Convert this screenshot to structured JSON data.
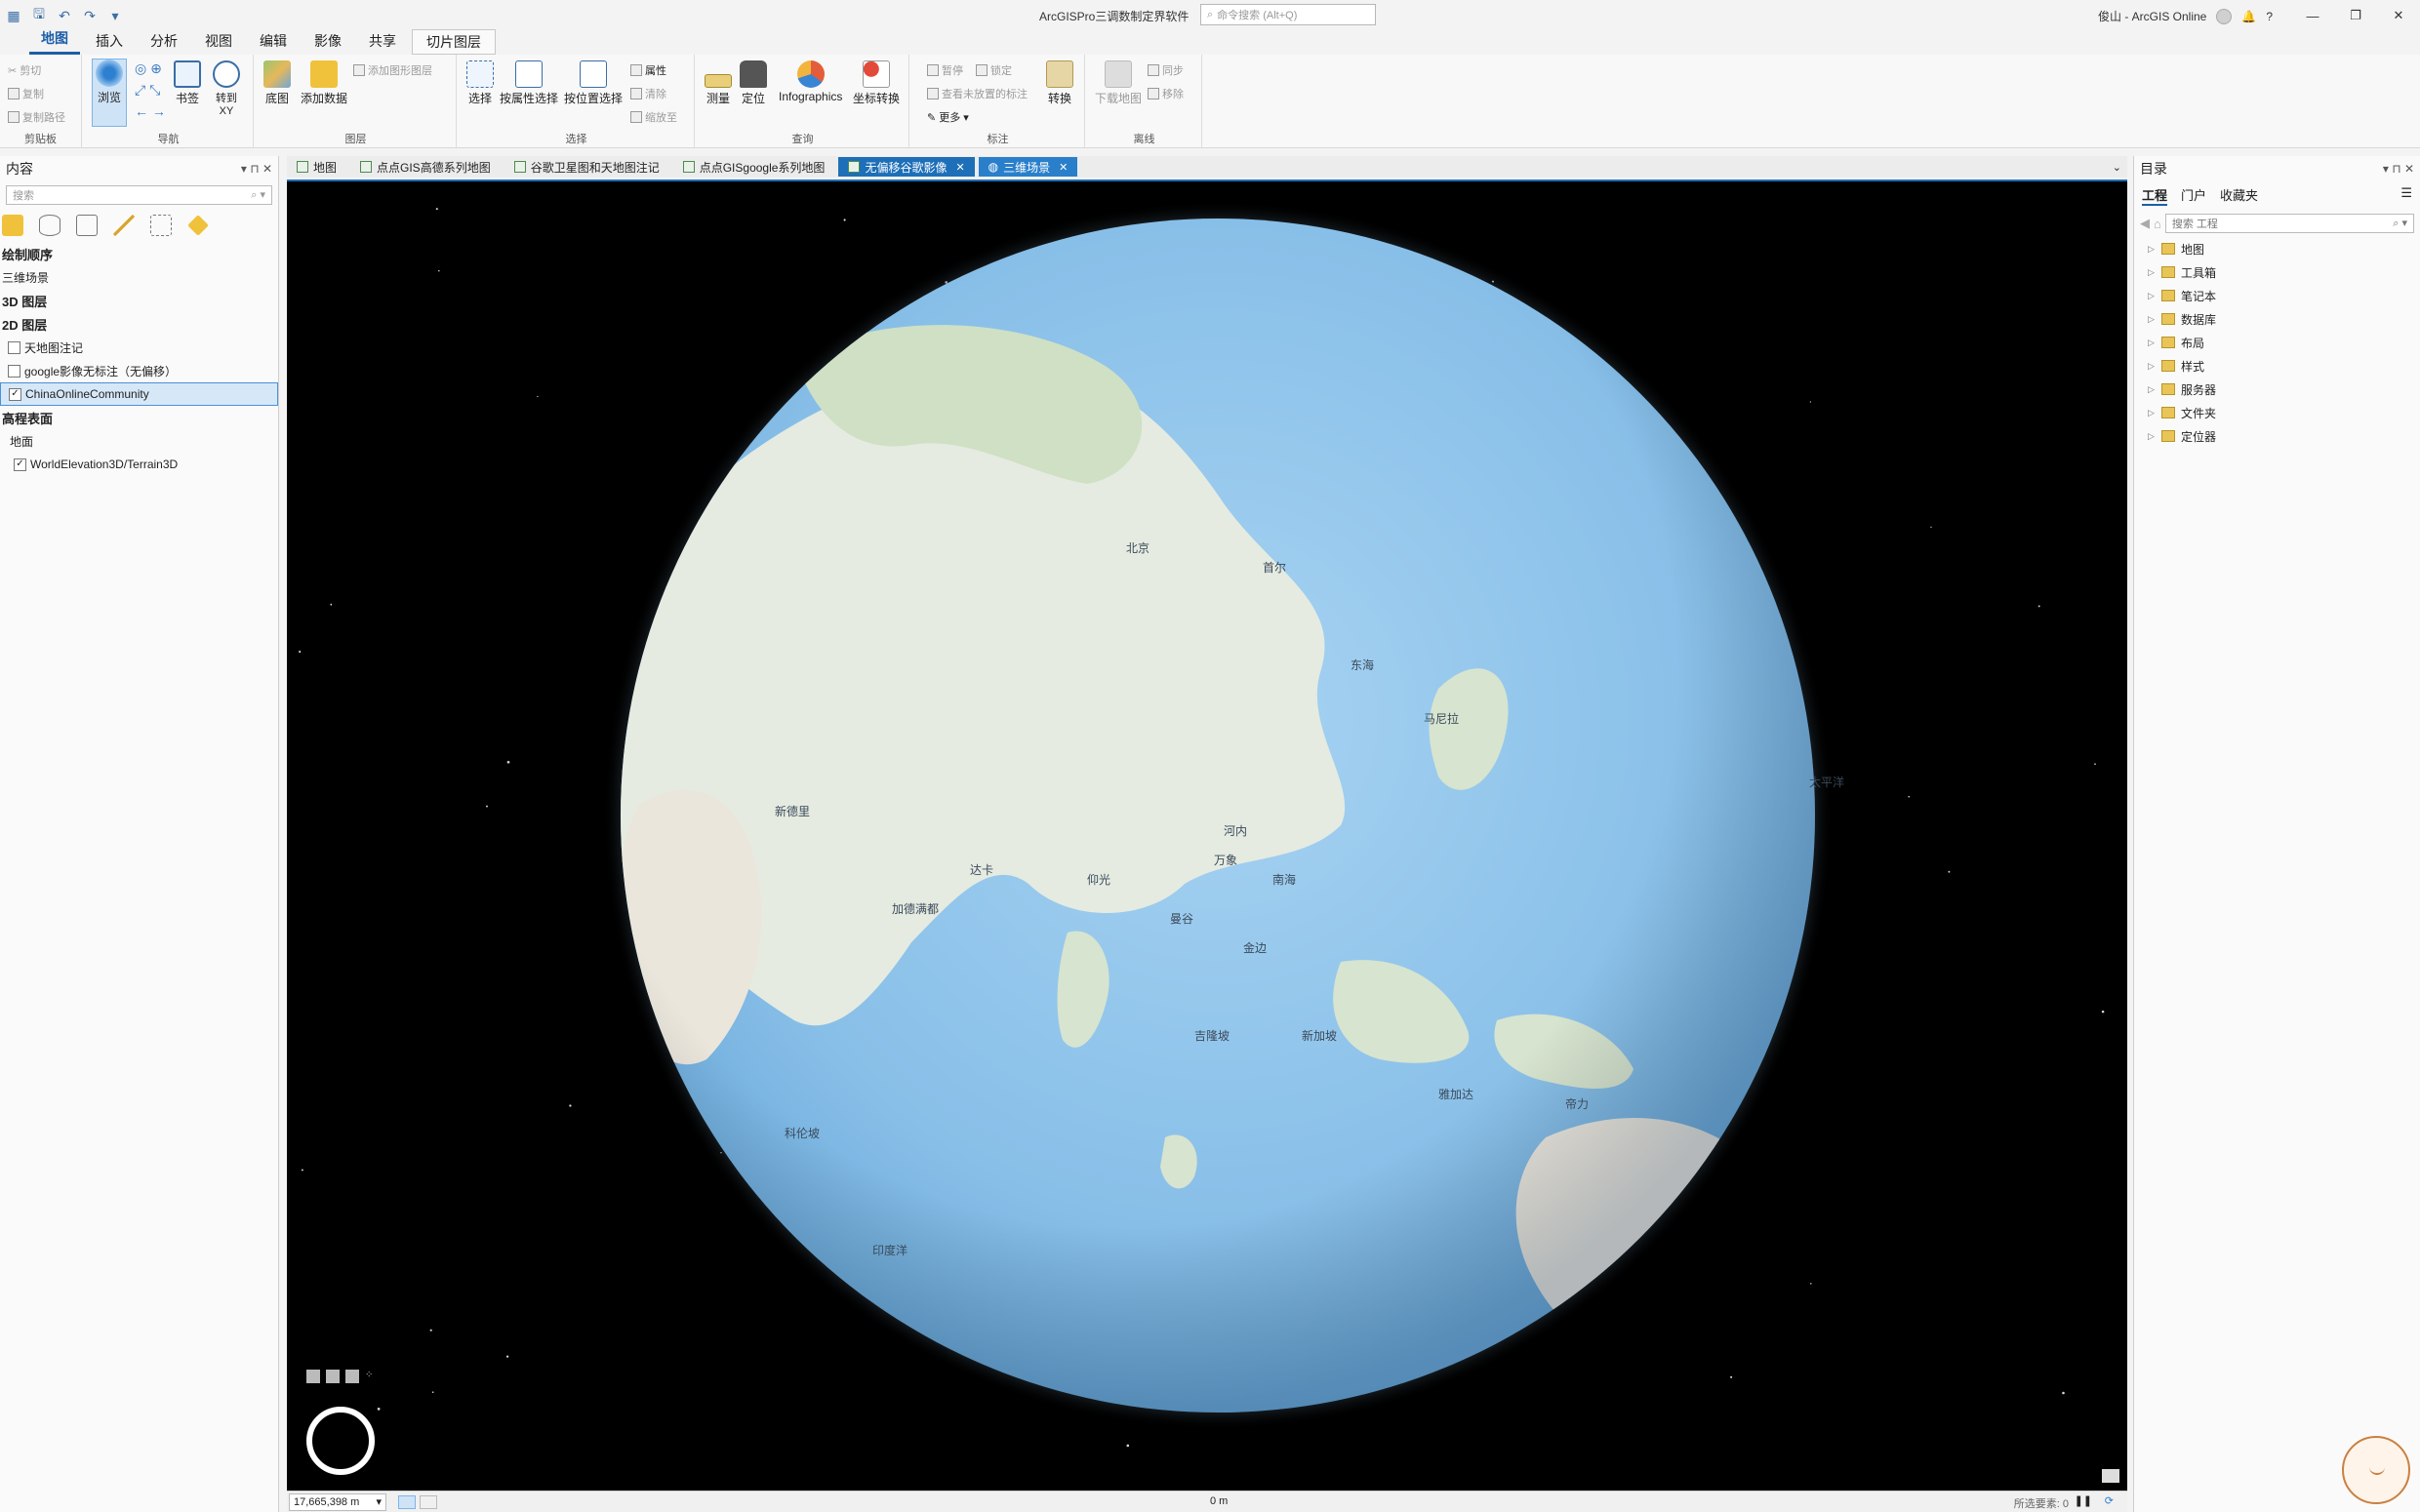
{
  "titlebar": {
    "title": "ArcGISPro三调数制定界软件",
    "search_placeholder": "命令搜索 (Alt+Q)",
    "user": "俊山 - ArcGIS Online",
    "help": "?"
  },
  "ribbon_tabs": [
    "地图",
    "插入",
    "分析",
    "视图",
    "编辑",
    "影像",
    "共享"
  ],
  "ribbon_context_tab": "切片图层",
  "ribbon": {
    "clipboard": {
      "cut": "剪切",
      "copy": "复制",
      "copy_path": "复制路径",
      "label": "剪贴板"
    },
    "navigate": {
      "explore": "浏览",
      "bookmarks": "书签",
      "goto_xy": "转到 XY",
      "label": "导航"
    },
    "layer": {
      "basemap": "底图",
      "add_data": "添加数据",
      "add_graphics": "添加图形图层",
      "label": "图层"
    },
    "selection": {
      "select": "选择",
      "by_attr": "按属性选择",
      "by_loc": "按位置选择",
      "attributes": "属性",
      "clear": "清除",
      "zoom_to": "缩放至",
      "label": "选择"
    },
    "inquiry": {
      "measure": "测量",
      "locate": "定位",
      "infographics": "Infographics",
      "convert_coords": "坐标转换",
      "label": "查询"
    },
    "labeling": {
      "pause": "暂停",
      "lock": "锁定",
      "view_unplaced": "查看未放置的标注",
      "more": "更多",
      "convert": "转换",
      "label": "标注"
    },
    "offline": {
      "download": "下载地图",
      "sync": "同步",
      "remove": "移除",
      "label": "离线"
    }
  },
  "contents": {
    "title": "内容",
    "search_placeholder": "搜索",
    "draw_order": "绘制顺序",
    "scene": "三维场景",
    "layers_3d": "3D 图层",
    "layers_2d": "2D 图层",
    "layer_items": [
      {
        "name": "天地图注记",
        "checked": false
      },
      {
        "name": "google影像无标注（无偏移）",
        "checked": false
      },
      {
        "name": "ChinaOnlineCommunity",
        "checked": true
      }
    ],
    "elevation": "高程表面",
    "ground": "地面",
    "elevation_item": {
      "name": "WorldElevation3D/Terrain3D",
      "checked": true
    }
  },
  "map_tabs": [
    {
      "label": "地图"
    },
    {
      "label": "点点GIS高德系列地图"
    },
    {
      "label": "谷歌卫星图和天地图注记"
    },
    {
      "label": "点点GISgoogle系列地图"
    },
    {
      "label": "无偏移谷歌影像",
      "active": true
    },
    {
      "label": "三维场景",
      "globe": true
    }
  ],
  "map": {
    "labels": [
      "北京",
      "马尼拉",
      "河内",
      "万象",
      "曼谷",
      "金边",
      "仰光",
      "达卡",
      "加德满都",
      "新德里",
      "科伦坡",
      "吉隆坡",
      "新加坡",
      "雅加达",
      "帝力",
      "首尔",
      "南海",
      "东海",
      "印度洋",
      "太平洋"
    ]
  },
  "statusbar": {
    "scale": "17,665,398 m",
    "coord": "0 m",
    "selected": "所选要素: 0"
  },
  "catalog": {
    "title": "目录",
    "tabs": [
      "工程",
      "门户",
      "收藏夹"
    ],
    "search_placeholder": "搜索 工程",
    "items": [
      "地图",
      "工具箱",
      "笔记本",
      "数据库",
      "布局",
      "样式",
      "服务器",
      "文件夹",
      "定位器"
    ]
  },
  "colors": {
    "accent": "#1d6fb8",
    "ocean": "#8fc4ea",
    "land": "#e6ebe3",
    "space": "#000000",
    "folder": "#e8c556"
  }
}
